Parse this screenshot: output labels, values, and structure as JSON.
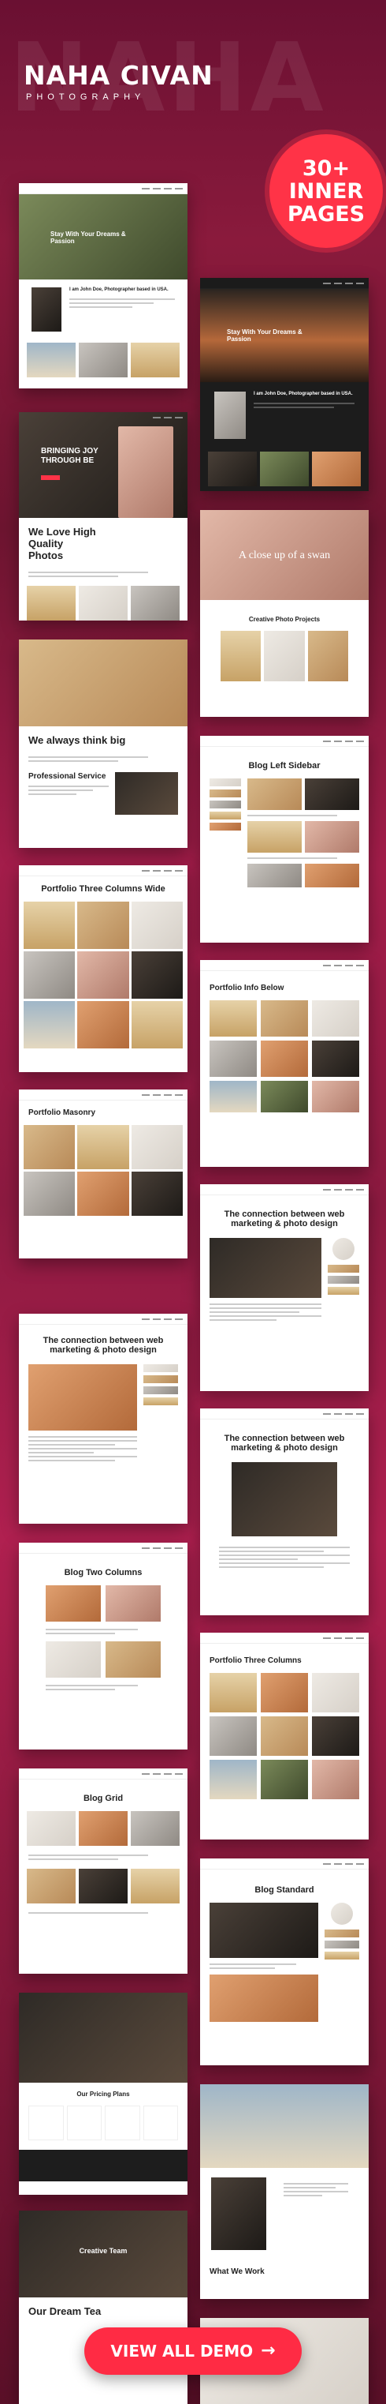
{
  "bigword": "NAHA",
  "brand": {
    "name": "NAHA CIVAN",
    "sub": "PHOTOGRAPHY"
  },
  "badge": {
    "line1": "30+",
    "line2": "INNER",
    "line3": "PAGES"
  },
  "cards": {
    "home1_hero": "Stay With Your Dreams & Passion",
    "home1_about": "I am John Doe, Photographer based in USA.",
    "home2_hero": "Stay With Your Dreams & Passion",
    "home2_about": "I am John Doe, Photographer based in USA.",
    "home3_hero": "BRINGING JOY THROUGH BE",
    "home3_title": "We Love High Quality Photos",
    "home4_hero": "A close up of a swan",
    "home4_section": "Creative Photo Projects",
    "home5_title": "We always think big",
    "home5_sub": "Professional Service",
    "blog_left_sidebar": "Blog Left Sidebar",
    "portfolio_three_wide": "Portfolio Three Columns Wide",
    "portfolio_info_below": "Portfolio Info Below",
    "portfolio_masonry": "Portfolio Masonry",
    "single_post_1": "The connection between web marketing & photo design",
    "single_post_2": "The connection between web marketing & photo design",
    "single_post_3": "The connection between web marketing & photo design",
    "blog_two_columns": "Blog Two Columns",
    "portfolio_three_columns": "Portfolio Three Columns",
    "blog_grid": "Blog Grid",
    "blog_standard": "Blog Standard",
    "pricing": "Our Pricing Plans",
    "what_we_work": "What We Work",
    "dream_team": "Our Dream Tea",
    "creative_team": "Creative Team"
  },
  "cta": {
    "label": "VIEW ALL DEMO",
    "arrow": "→"
  },
  "colors": {
    "accent": "#ff3347",
    "bg_top": "#6a1032",
    "bg_mid": "#a31d4a"
  }
}
